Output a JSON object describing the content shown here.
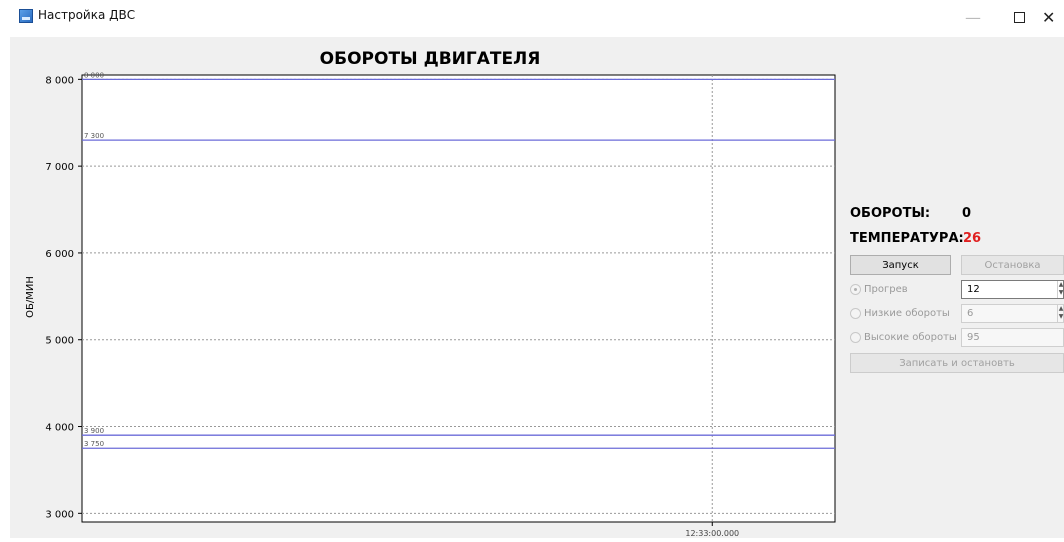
{
  "window": {
    "title": "Настройка ДВС",
    "minimize_glyph": "—",
    "close_glyph": "✕"
  },
  "chart_data": {
    "type": "line",
    "title": "ОБОРОТЫ ДВИГАТЕЛЯ",
    "ylabel": "ОБ/МИН",
    "xlabel": "",
    "ylim": [
      2900,
      8050
    ],
    "yticks": [
      3000,
      4000,
      5000,
      6000,
      7000,
      8000
    ],
    "ytick_labels": [
      "3 000",
      "4 000",
      "5 000",
      "6 000",
      "7 000",
      "8 000"
    ],
    "xtick_labels": [
      "12:33:00.000"
    ],
    "grid": true,
    "series": [],
    "threshold_lines": [
      {
        "value": 8000,
        "label": "8 000"
      },
      {
        "value": 7300,
        "label": "7 300"
      },
      {
        "value": 3900,
        "label": "3 900"
      },
      {
        "value": 3750,
        "label": "3 750"
      }
    ],
    "line_color": "#6b6bd8"
  },
  "status": {
    "rpm_label": "ОБОРОТЫ:",
    "rpm_value": "0",
    "temp_label": "ТЕМПЕРАТУРА:",
    "temp_value": "26",
    "temp_color": "#e02020"
  },
  "controls": {
    "start_label": "Запуск",
    "stop_label": "Остановка",
    "modes": [
      {
        "label": "Прогрев",
        "value": "12",
        "checked": true
      },
      {
        "label": "Низкие обороты",
        "value": "6",
        "checked": false
      },
      {
        "label": "Высокие обороты",
        "value": "95",
        "checked": false
      }
    ],
    "record_stop_label": "Записать и остановть"
  }
}
